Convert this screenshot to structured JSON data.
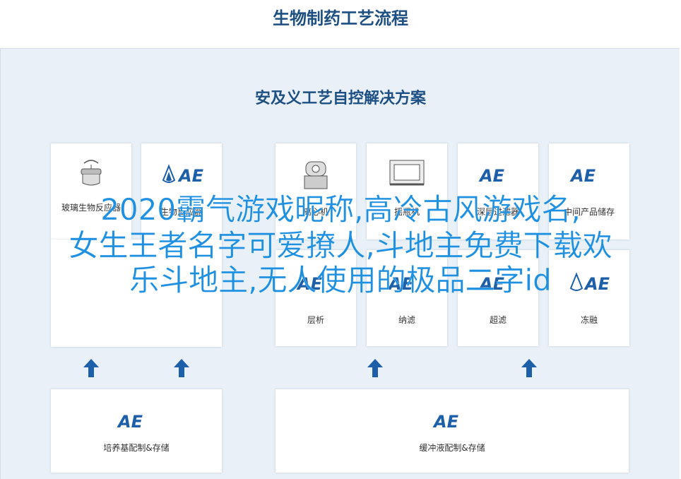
{
  "title": "生物制药工艺流程",
  "subtitle": "安及义工艺自控解决方案",
  "brand": {
    "text": "AE",
    "color": "#1d5fa8"
  },
  "colors": {
    "accent": "#1d4f82",
    "overlay": "#1e8fe1",
    "arrow": "#1d5fa8",
    "panel": "#e9f0f8"
  },
  "top_cards": [
    {
      "label": "玻璃生物反应器",
      "icon": "bioreactor-icon"
    },
    {
      "label": "生物反应器",
      "icon": "ae-logo"
    },
    {
      "label": "离心机",
      "icon": "centrifuge-icon"
    },
    {
      "label": "摇瓶机",
      "icon": "shaker-icon"
    },
    {
      "label": "深层过滤器",
      "icon": "ae-logo"
    },
    {
      "label": "中间产品储存",
      "icon": "ae-logo"
    }
  ],
  "mid_cards": [
    {
      "label": "层析",
      "icon": "ae-logo"
    },
    {
      "label": "纳滤",
      "icon": "ae-logo"
    },
    {
      "label": "超滤",
      "icon": "ae-logo"
    },
    {
      "label": "冻融",
      "icon": "ae-logo"
    }
  ],
  "bottom_cards": [
    {
      "label": "培养基配制&存储",
      "icon": "ae-logo"
    },
    {
      "label": "缓冲液配制&存储",
      "icon": "ae-logo"
    }
  ],
  "overlay_lines": [
    "2020霸气游戏昵称,高冷古风游戏名,",
    "女生王者名字可爱撩人,斗地主免费下载欢",
    "乐斗地主,无人使用的极品二字id"
  ]
}
